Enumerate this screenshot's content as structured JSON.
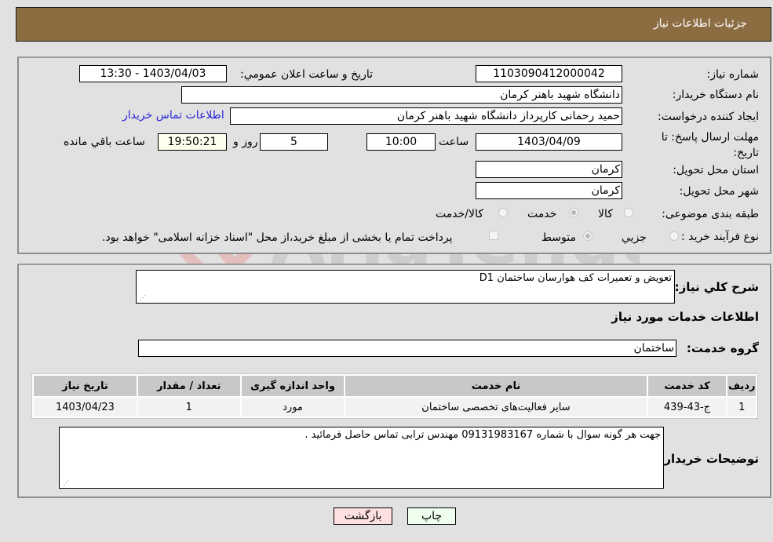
{
  "header": {
    "title": "جزئیات اطلاعات نیاز"
  },
  "form": {
    "need_number": {
      "label": "شماره نیاز:",
      "value": "1103090412000042"
    },
    "announce_datetime": {
      "label": "تاریخ و ساعت اعلان عمومي:",
      "value": "1403/04/03 - 13:30"
    },
    "buyer_org": {
      "label": "نام دستگاه خریدار:",
      "value": "دانشگاه شهید باهنر کرمان"
    },
    "requester": {
      "label": "ایجاد کننده درخواست:",
      "value": "حمید  رحمانی کارپرداز دانشگاه شهید باهنر کرمان"
    },
    "buyer_contact_link": "اطلاعات تماس خریدار",
    "deadline": {
      "label": "مهلت ارسال پاسخ: تا تاریخ:",
      "date": "1403/04/09",
      "time_label": "ساعت",
      "time": "10:00",
      "days": "5",
      "days_label": "روز و",
      "remaining": "19:50:21",
      "remaining_label": "ساعت باقي مانده"
    },
    "province": {
      "label": "استان محل تحویل:",
      "value": "کرمان"
    },
    "city": {
      "label": "شهر محل تحویل:",
      "value": "کرمان"
    },
    "category": {
      "label": "طبقه بندی موضوعی:",
      "options": [
        "کالا",
        "خدمت",
        "کالا/خدمت"
      ],
      "selected": "خدمت"
    },
    "purchase_process": {
      "label": "نوع فرآیند خرید :",
      "options": [
        "جزیي",
        "متوسط"
      ],
      "selected": "متوسط",
      "treasury_note": "پرداخت تمام یا بخشی از مبلغ خرید،از محل \"اسناد خزانه اسلامی\" خواهد بود."
    }
  },
  "details": {
    "description_label": "شرح کلي نیاز:",
    "description": "تعویض و تعمیرات کف هوارسان ساختمان D1",
    "services_heading": "اطلاعات خدمات مورد نیاز",
    "service_group_label": "گروه خدمت:",
    "service_group": "ساختمان",
    "table": {
      "headers": [
        "ردیف",
        "کد خدمت",
        "نام خدمت",
        "واحد اندازه گیری",
        "تعداد / مقدار",
        "تاریخ نیاز"
      ],
      "rows": [
        [
          "1",
          "ج-43-439",
          "سایر فعالیت‌های تخصصی ساختمان",
          "مورد",
          "1",
          "1403/04/23"
        ]
      ]
    },
    "buyer_notes_label": "توضیحات خریدار:",
    "buyer_notes": "جهت هر گونه سوال با شماره 09131983167 مهندس ترابی تماس حاصل فرمائید ."
  },
  "buttons": {
    "print": "چاپ",
    "back": "بازگشت"
  },
  "watermark": "AriaTender.neT",
  "colors": {
    "header_bg": "#8c6d42",
    "link": "#2828d8",
    "print_bg": "#eeffee",
    "back_bg": "#ffe0e0"
  }
}
